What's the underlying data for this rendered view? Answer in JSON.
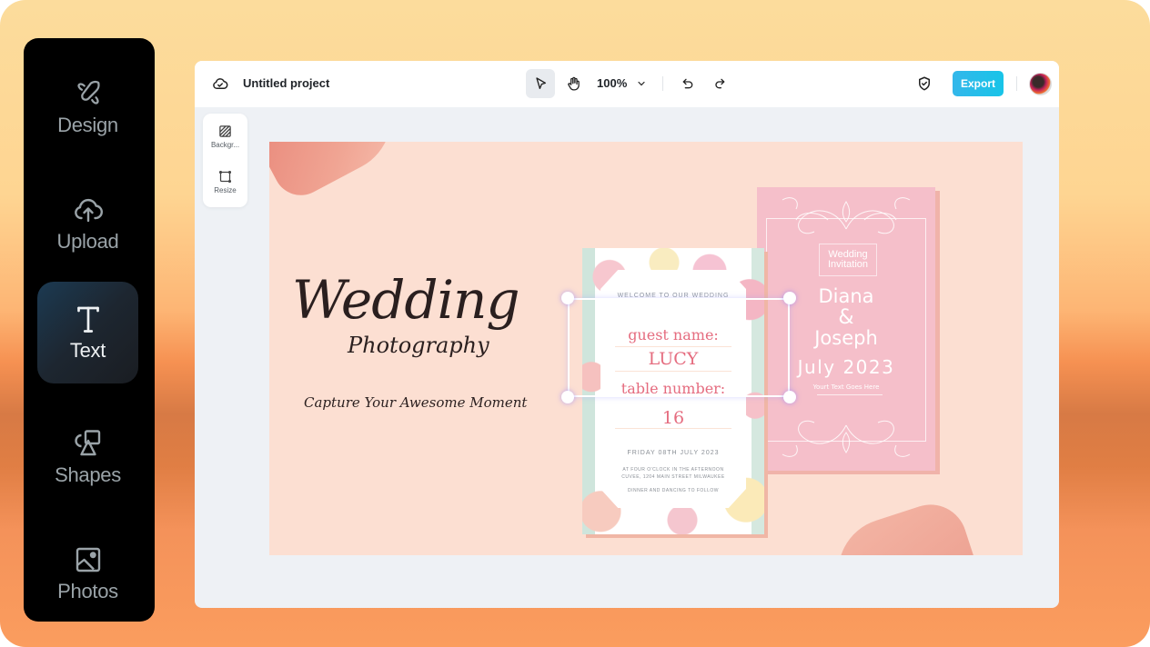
{
  "sidebar": {
    "items": [
      {
        "label": "Design",
        "icon": "design-icon",
        "active": false
      },
      {
        "label": "Upload",
        "icon": "upload-icon",
        "active": false
      },
      {
        "label": "Text",
        "icon": "text-icon",
        "active": true
      },
      {
        "label": "Shapes",
        "icon": "shapes-icon",
        "active": false
      },
      {
        "label": "Photos",
        "icon": "photos-icon",
        "active": false
      }
    ]
  },
  "topbar": {
    "project_title": "Untitled project",
    "zoom_level": "100%",
    "export_label": "Export",
    "cloud_icon": "cloud-check-icon",
    "select_tool_icon": "pointer-icon",
    "hand_tool_icon": "hand-icon",
    "undo_icon": "undo-icon",
    "redo_icon": "redo-icon",
    "shield_icon": "shield-check-icon"
  },
  "float_tools": {
    "items": [
      {
        "label": "Backgr...",
        "icon": "background-icon"
      },
      {
        "label": "Resize",
        "icon": "resize-icon"
      }
    ]
  },
  "canvas": {
    "headline": "Wedding",
    "subheadline": "Photography",
    "tagline": "Capture Your Awesome Moment",
    "card1": {
      "welcome": "WELCOME TO OUR WEDDING",
      "guest_label": "guest name:",
      "guest_value": "LUCY",
      "table_label": "table number:",
      "table_value": "16",
      "date": "FRIDAY 08TH JULY 2023",
      "time": "AT FOUR O'CLOCK IN THE AFTERNOON",
      "address": "CUVEE, 1204 MAIN STREET MILWAUKEE",
      "dinner": "DINNER AND DANCING TO FOLLOW"
    },
    "card2": {
      "title_line1": "Wedding",
      "title_line2": "Invitation",
      "name1": "Diana",
      "ampersand": "&",
      "name2": "Joseph",
      "date": "July 2023",
      "placeholder": "Yourt Text Goes Here"
    }
  },
  "colors": {
    "accent_export": "#2dbdea",
    "canvas_bg": "#fcdfd2",
    "card_pink": "#f5bfca",
    "script_pink": "#e56c7f"
  }
}
